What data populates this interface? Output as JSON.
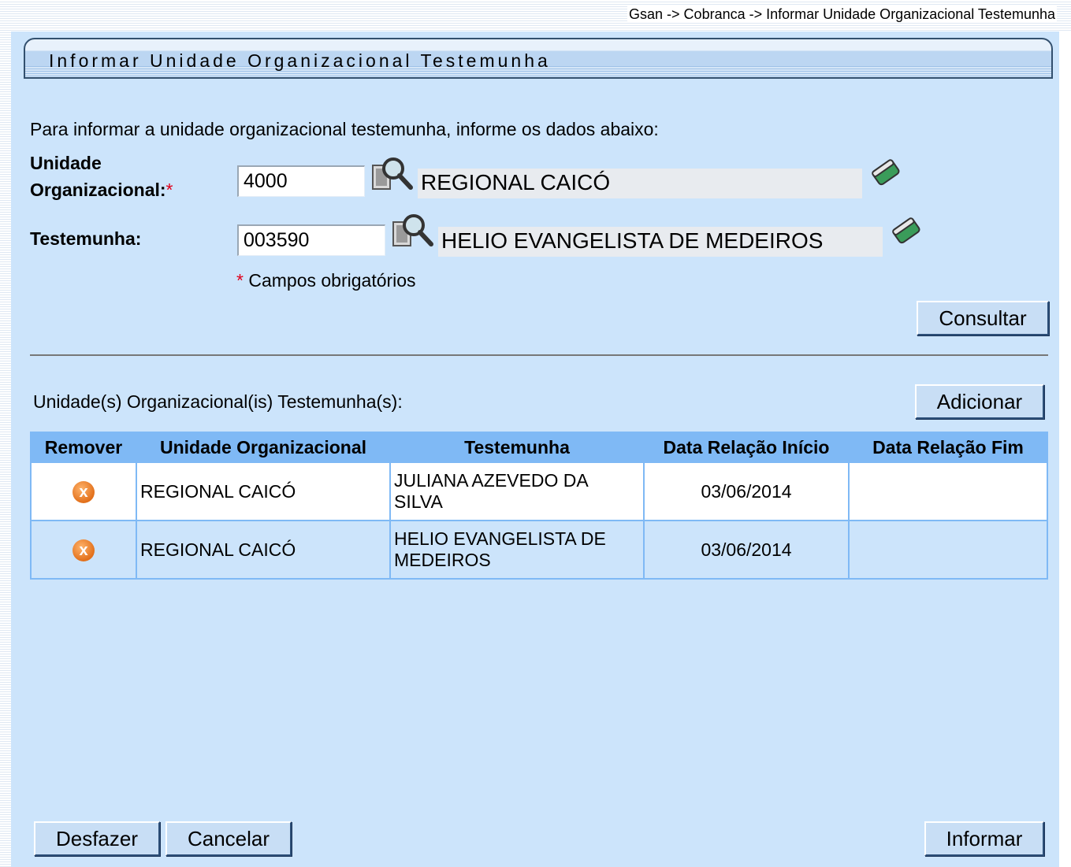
{
  "breadcrumb": "Gsan -> Cobranca -> Informar Unidade Organizacional Testemunha",
  "title": "Informar Unidade Organizacional Testemunha",
  "intro": "Para informar a unidade organizacional testemunha, informe os dados abaixo:",
  "form": {
    "unidade_label_1": "Unidade",
    "unidade_label_2": "Organizacional:",
    "required_mark": "*",
    "unidade_code": "4000",
    "unidade_name": "REGIONAL  CAICÓ",
    "testemunha_label": "Testemunha:",
    "testemunha_code": "003590",
    "testemunha_name": "HELIO EVANGELISTA DE MEDEIROS",
    "required_note": "Campos obrigatórios"
  },
  "buttons": {
    "consultar": "Consultar",
    "adicionar": "Adicionar",
    "desfazer": "Desfazer",
    "cancelar": "Cancelar",
    "informar": "Informar"
  },
  "list_label": "Unidade(s) Organizacional(is) Testemunha(s):",
  "table": {
    "headers": [
      "Remover",
      "Unidade Organizacional",
      "Testemunha",
      "Data Relação Início",
      "Data Relação Fim"
    ],
    "rows": [
      {
        "unidade": "REGIONAL CAICÓ",
        "testemunha": "JULIANA AZEVEDO DA SILVA",
        "inicio": "03/06/2014",
        "fim": ""
      },
      {
        "unidade": "REGIONAL CAICÓ",
        "testemunha": "HELIO EVANGELISTA DE MEDEIROS",
        "inicio": "03/06/2014",
        "fim": ""
      }
    ]
  },
  "icons": {
    "search": "magnifier-icon",
    "clear": "eraser-icon",
    "remove": "remove-icon"
  },
  "colors": {
    "panel": "#cce4fb",
    "header": "#7fb9f5",
    "remove": "#e2701b",
    "required": "#e0001b"
  }
}
